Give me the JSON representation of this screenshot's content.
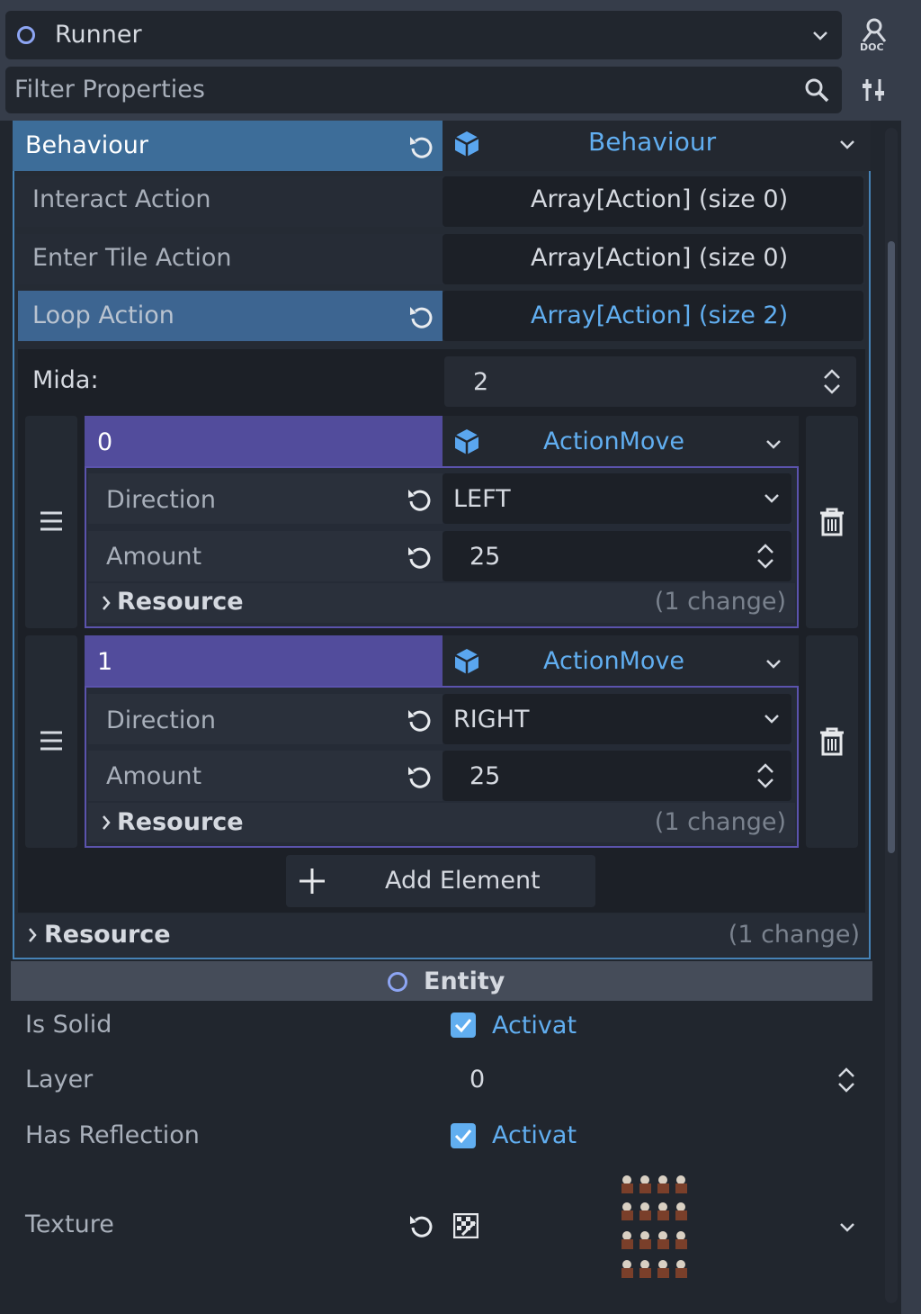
{
  "header": {
    "node_name": "Runner",
    "filter_placeholder": "Filter Properties"
  },
  "behaviour": {
    "label": "Behaviour",
    "value": "Behaviour",
    "properties": [
      {
        "label": "Interact Action",
        "value": "Array[Action] (size 0)"
      },
      {
        "label": "Enter Tile Action",
        "value": "Array[Action] (size 0)"
      },
      {
        "label": "Loop Action",
        "value": "Array[Action] (size 2)"
      }
    ],
    "array": {
      "size_label": "Mida:",
      "size_value": "2",
      "elements": [
        {
          "index": "0",
          "type": "ActionMove",
          "direction_label": "Direction",
          "direction": "LEFT",
          "amount_label": "Amount",
          "amount": "25",
          "resource_label": "Resource",
          "changes": "(1 change)"
        },
        {
          "index": "1",
          "type": "ActionMove",
          "direction_label": "Direction",
          "direction": "RIGHT",
          "amount_label": "Amount",
          "amount": "25",
          "resource_label": "Resource",
          "changes": "(1 change)"
        }
      ],
      "add_label": "Add Element"
    },
    "resource_label": "Resource",
    "resource_changes": "(1 change)"
  },
  "entity": {
    "title": "Entity",
    "rows": [
      {
        "label": "Is Solid",
        "value": "Activat"
      },
      {
        "label": "Layer",
        "value": "0"
      },
      {
        "label": "Has Reflection",
        "value": "Activat"
      },
      {
        "label": "Texture",
        "value": ""
      }
    ]
  },
  "colors": {
    "accent_blue": "#61aef0",
    "section_blue": "#3d6d99",
    "element_purple": "#524c9c",
    "panel_bg": "#21262e"
  },
  "icons": [
    "node-circle-icon",
    "chevron-down-icon",
    "doc-icon",
    "search-icon",
    "tools-icon",
    "revert-icon",
    "cube-icon",
    "spinner-icon",
    "drag-handle-icon",
    "trash-icon",
    "chevron-right-icon",
    "plus-icon",
    "checkbox-checked-icon",
    "texture-icon"
  ]
}
